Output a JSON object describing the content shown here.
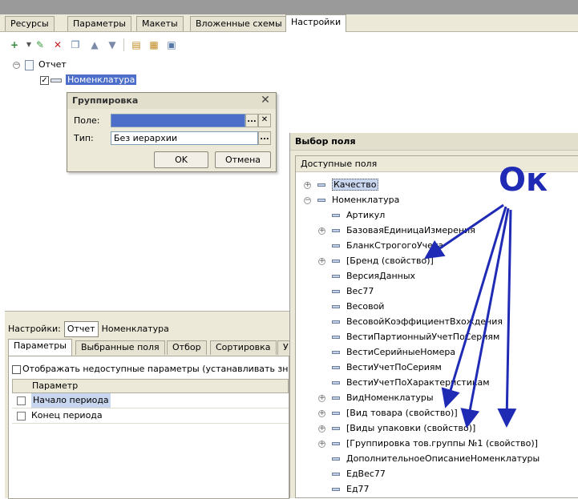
{
  "tabs": [
    "Ресурсы",
    "Параметры",
    "Макеты",
    "Вложенные схемы",
    "Настройки"
  ],
  "active_tab": "Настройки",
  "toolbar": [
    {
      "icon": "add-icon"
    },
    {
      "icon": "edit-icon"
    },
    {
      "icon": "delete-icon"
    },
    {
      "icon": "copy-icon"
    },
    {
      "icon": "move-up-icon"
    },
    {
      "icon": "move-down-icon"
    },
    {
      "icon": "group-icon"
    },
    {
      "icon": "group-add-icon"
    },
    {
      "icon": "layout-icon"
    }
  ],
  "tree": {
    "root": "Отчет",
    "child": "Номенклатура"
  },
  "dialog": {
    "title": "Группировка",
    "field_label": "Поле:",
    "field_value": "",
    "type_label": "Тип:",
    "type_value": "Без иерархии",
    "ellipsis": "...",
    "clear": "✕",
    "ok": "OK",
    "cancel": "Отмена"
  },
  "settings": {
    "label": "Настройки:",
    "pill": "Отчет",
    "value": "Номенклатура",
    "tabs": [
      "Параметры",
      "Выбранные поля",
      "Отбор",
      "Сортировка",
      "У"
    ],
    "active_tab": "Параметры",
    "show_unavailable": "Отображать недоступные параметры (устанавливать значения н",
    "grid_header": "Параметр",
    "rows": [
      "Начало периода",
      "Конец периода"
    ]
  },
  "field_picker": {
    "title": "Выбор поля",
    "header": "Доступные поля",
    "items": [
      {
        "text": "Качество",
        "level": 0,
        "expander": "+"
      },
      {
        "text": "Номенклатура",
        "level": 0,
        "expander": "−"
      },
      {
        "text": "Артикул",
        "level": 1,
        "expander": ""
      },
      {
        "text": "БазоваяЕдиницаИзмерения",
        "level": 1,
        "expander": "+"
      },
      {
        "text": "БланкСтрогогоУчета",
        "level": 1,
        "expander": ""
      },
      {
        "text": "[Бренд (свойство)]",
        "level": 1,
        "expander": "+"
      },
      {
        "text": "ВерсияДанных",
        "level": 1,
        "expander": ""
      },
      {
        "text": "Вес77",
        "level": 1,
        "expander": ""
      },
      {
        "text": "Весовой",
        "level": 1,
        "expander": ""
      },
      {
        "text": "ВесовойКоэффициентВхождения",
        "level": 1,
        "expander": ""
      },
      {
        "text": "ВестиПартионныйУчетПоСериям",
        "level": 1,
        "expander": ""
      },
      {
        "text": "ВестиСерийныеНомера",
        "level": 1,
        "expander": ""
      },
      {
        "text": "ВестиУчетПоСериям",
        "level": 1,
        "expander": ""
      },
      {
        "text": "ВестиУчетПоХарактеристикам",
        "level": 1,
        "expander": ""
      },
      {
        "text": "ВидНоменклатуры",
        "level": 1,
        "expander": "+"
      },
      {
        "text": "[Вид товара (свойство)]",
        "level": 1,
        "expander": "+"
      },
      {
        "text": "[Виды упаковки (свойство)]",
        "level": 1,
        "expander": "+"
      },
      {
        "text": "[Группировка тов.группы №1 (свойство)]",
        "level": 1,
        "expander": "+"
      },
      {
        "text": "ДополнительноеОписаниеНоменклатуры",
        "level": 1,
        "expander": ""
      },
      {
        "text": "ЕдВес77",
        "level": 1,
        "expander": ""
      },
      {
        "text": "Ед77",
        "level": 1,
        "expander": ""
      }
    ]
  },
  "annotation": "Ок",
  "colors": {
    "annotation": "#1f2bb5",
    "selection": "#4e6fc9"
  }
}
